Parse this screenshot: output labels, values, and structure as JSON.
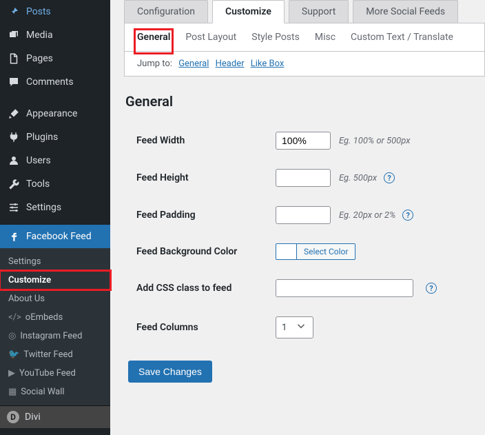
{
  "sidebar": {
    "main": [
      "Posts",
      "Media",
      "Pages",
      "Comments",
      "Appearance",
      "Plugins",
      "Users",
      "Tools",
      "Settings"
    ],
    "active": {
      "label": "Facebook Feed",
      "sub": [
        "Settings",
        "Customize",
        "About Us",
        "oEmbeds",
        "Instagram Feed",
        "Twitter Feed",
        "YouTube Feed",
        "Social Wall"
      ]
    },
    "divi": "Divi"
  },
  "tabs": {
    "main": [
      "Configuration",
      "Customize",
      "Support",
      "More Social Feeds"
    ],
    "sub": [
      "General",
      "Post Layout",
      "Style Posts",
      "Misc",
      "Custom Text / Translate"
    ]
  },
  "jumpto": {
    "label": "Jump to:",
    "links": [
      "General",
      "Header",
      "Like Box"
    ]
  },
  "section": {
    "title": "General"
  },
  "form": {
    "width": {
      "label": "Feed Width",
      "value": "100%",
      "hint": "Eg. 100% or 500px"
    },
    "height": {
      "label": "Feed Height",
      "value": "",
      "hint": "Eg. 500px"
    },
    "padding": {
      "label": "Feed Padding",
      "value": "",
      "hint": "Eg. 20px or 2%"
    },
    "bgcolor": {
      "label": "Feed Background Color",
      "button": "Select Color"
    },
    "cssclass": {
      "label": "Add CSS class to feed",
      "value": ""
    },
    "columns": {
      "label": "Feed Columns",
      "value": "1"
    }
  },
  "buttons": {
    "save": "Save Changes"
  },
  "colors": {
    "accent": "#2271b1",
    "highlight": "#ec1c24",
    "sidebar_bg": "#1d2327"
  }
}
